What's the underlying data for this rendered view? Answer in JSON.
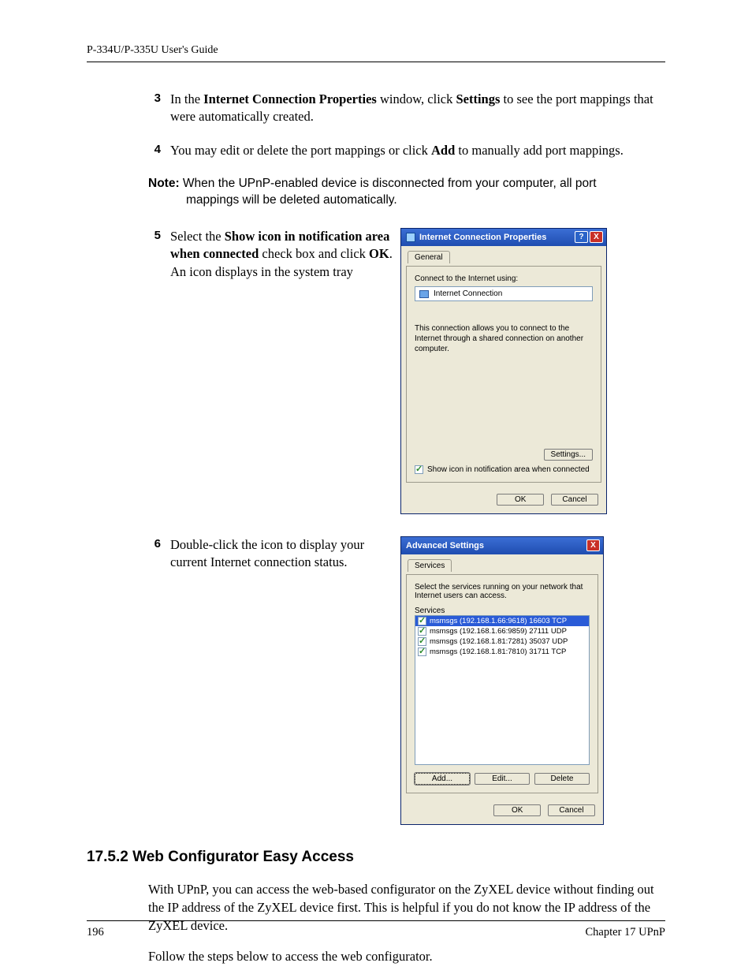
{
  "header": {
    "running_head": "P-334U/P-335U User's Guide"
  },
  "steps": {
    "s3": {
      "num": "3",
      "pre": "In the ",
      "b1": "Internet Connection Properties",
      "mid1": " window, click ",
      "b2": "Settings",
      "post": " to see the port mappings that were automatically created."
    },
    "s4": {
      "num": "4",
      "pre": "You may edit or delete the port mappings or click ",
      "b1": "Add",
      "post": " to manually add port mappings."
    },
    "s5": {
      "num": "5",
      "pre": "Select the ",
      "b1": "Show icon in notification area when connected",
      "mid1": " check box and click ",
      "b2": "OK",
      "post": ". An icon displays in the system tray"
    },
    "s6": {
      "num": "6",
      "text": "Double-click the icon to display your current Internet connection status."
    }
  },
  "note": {
    "label": "Note:",
    "line1": " When the UPnP-enabled device is disconnected from your computer, all port",
    "line2": "mappings will be deleted automatically."
  },
  "dialog1": {
    "title": "Internet Connection Properties",
    "tab": "General",
    "connect_label": "Connect to the Internet using:",
    "connection_name": "Internet Connection",
    "description": "This connection allows you to connect to the Internet through a shared connection on another computer.",
    "settings_btn": "Settings...",
    "checkbox_label": "Show icon in notification area when connected",
    "ok": "OK",
    "cancel": "Cancel"
  },
  "dialog2": {
    "title": "Advanced Settings",
    "tab": "Services",
    "instr": "Select the services running on your network that Internet users can access.",
    "list_header": "Services",
    "services": [
      "msmsgs (192.168.1.66:9618) 16603 TCP",
      "msmsgs (192.168.1.66:9859) 27111 UDP",
      "msmsgs (192.168.1.81:7281) 35037 UDP",
      "msmsgs (192.168.1.81:7810) 31711 TCP"
    ],
    "add": "Add...",
    "edit": "Edit...",
    "delete": "Delete",
    "ok": "OK",
    "cancel": "Cancel"
  },
  "section": {
    "heading": "17.5.2  Web Configurator Easy Access",
    "p1": "With UPnP, you can access the web-based configurator on the ZyXEL device without finding out the IP address of the ZyXEL device first. This is helpful if you do not know the IP address of the ZyXEL device.",
    "p2": "Follow the steps below to access the web configurator."
  },
  "footer": {
    "page": "196",
    "chapter": "Chapter 17 UPnP"
  }
}
